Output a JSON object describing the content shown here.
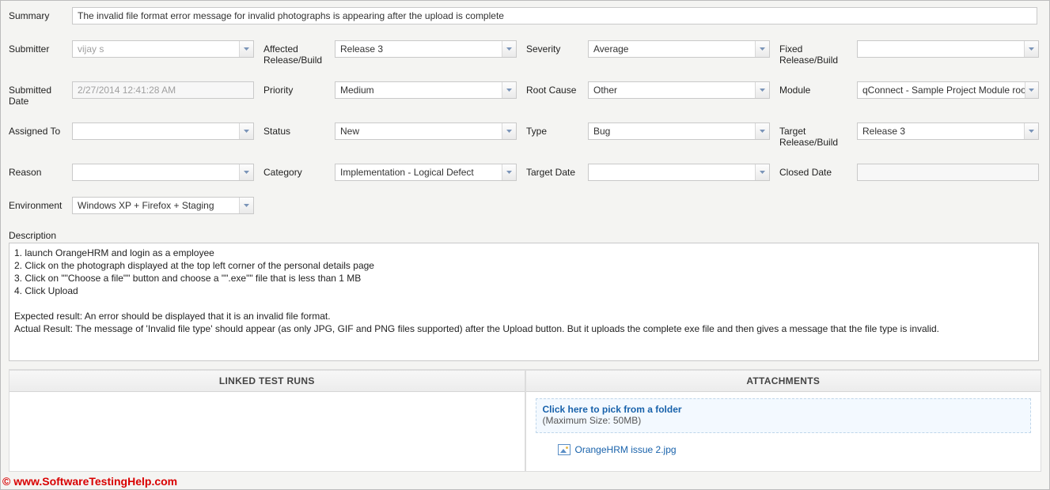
{
  "labels": {
    "summary": "Summary",
    "submitter": "Submitter",
    "affected": "Affected Release/Build",
    "severity": "Severity",
    "fixed": "Fixed Release/Build",
    "submitted_date": "Submitted Date",
    "priority": "Priority",
    "root_cause": "Root Cause",
    "module": "Module",
    "assigned_to": "Assigned To",
    "status": "Status",
    "type": "Type",
    "target": "Target Release/Build",
    "reason": "Reason",
    "category": "Category",
    "target_date": "Target Date",
    "closed_date": "Closed Date",
    "environment": "Environment",
    "description": "Description"
  },
  "fields": {
    "summary": "The invalid file format error message for invalid photographs is appearing after the upload is complete",
    "submitter": "vijay s",
    "affected": "Release 3",
    "severity": "Average",
    "fixed": "",
    "submitted_date": "2/27/2014 12:41:28 AM",
    "priority": "Medium",
    "root_cause": "Other",
    "module": "qConnect - Sample Project Module root",
    "assigned_to": "",
    "status": "New",
    "type": "Bug",
    "target": "Release 3",
    "reason": "",
    "category": "Implementation - Logical Defect",
    "target_date": "",
    "closed_date": "",
    "environment": "Windows XP + Firefox + Staging"
  },
  "description": "1. launch OrangeHRM and login as a employee\n2. Click on the photograph displayed at the top left corner of the personal details page\n3. Click on \"\"Choose a file\"\" button and choose a \"\".exe\"\" file that is less than 1 MB\n4. Click Upload\n\nExpected result: An error should be displayed that it is an invalid file format.\nActual Result: The message of 'Invalid file type' should appear (as only JPG, GIF and PNG files supported) after the Upload button. But it uploads the complete exe file and then gives a message that the file type is invalid.",
  "panels": {
    "linked": "LINKED TEST RUNS",
    "attachments": "ATTACHMENTS",
    "pick_link": "Click here to pick from a folder",
    "pick_sub": "(Maximum Size: 50MB)",
    "file": "OrangeHRM issue 2.jpg"
  },
  "watermark": "© www.SoftwareTestingHelp.com"
}
